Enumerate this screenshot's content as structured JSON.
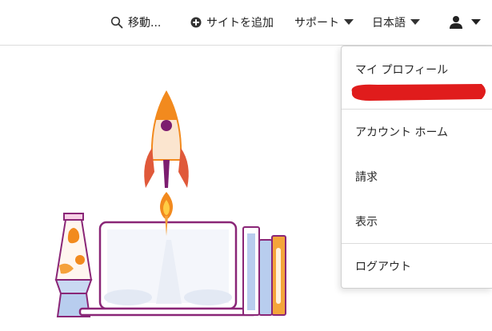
{
  "topbar": {
    "search_label": "移動...",
    "add_site_label": "サイトを追加",
    "support_label": "サポート",
    "language_label": "日本語"
  },
  "dropdown": {
    "items": [
      {
        "label": "マイ プロフィール"
      },
      {
        "label": "アカウント ホーム"
      },
      {
        "label": "請求"
      },
      {
        "label": "表示"
      },
      {
        "label": "ログアウト"
      }
    ]
  },
  "icons": [
    "search-icon",
    "plus-circle-icon",
    "caret-down-icon",
    "user-icon"
  ],
  "colors": {
    "redaction": "#e01c1c",
    "rocket_orange": "#f28a1e",
    "rocket_purple": "#7c1d6f",
    "laptop_outline": "#8a2677",
    "book_blue": "#b8cdee",
    "book_orange": "#f4a53a"
  }
}
